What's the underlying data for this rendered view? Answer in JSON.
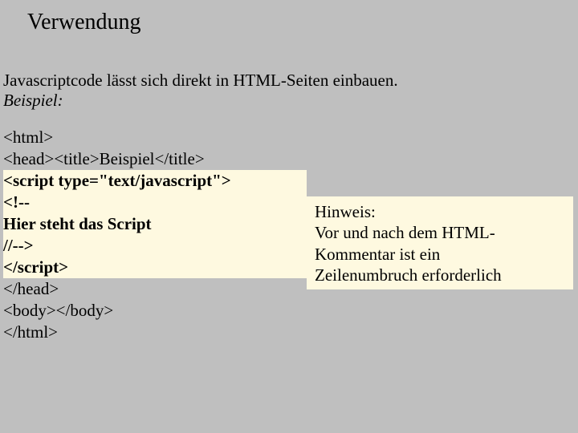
{
  "heading": "Verwendung",
  "intro": {
    "line1": "Javascriptcode lässt sich direkt in HTML-Seiten einbauen.",
    "line2": "Beispiel:"
  },
  "code": {
    "l1": "<html>",
    "l2": "<head><title>Beispiel</title>",
    "l3": "<script type=\"text/javascript\">",
    "l4": "<!--",
    "l5": "Hier steht das Script",
    "l6": "//-->",
    "l7": "</script>",
    "l8": "</head>",
    "l9": "<body></body>",
    "l10": "</html>"
  },
  "hint": {
    "l1": "Hinweis:",
    "l2": "Vor und nach dem HTML-",
    "l3": "Kommentar ist ein",
    "l4": "Zeilenumbruch erforderlich"
  }
}
